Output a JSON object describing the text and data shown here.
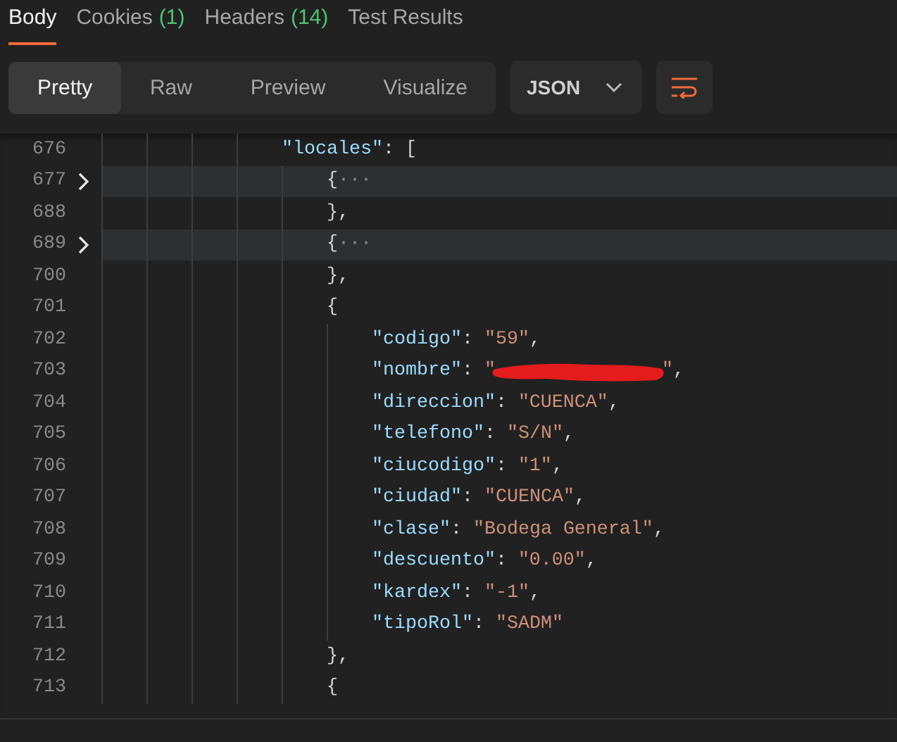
{
  "tabs": [
    {
      "label": "Body",
      "selected": true
    },
    {
      "label": "Cookies",
      "count": "(1)",
      "selected": false
    },
    {
      "label": "Headers",
      "count": "(14)",
      "selected": false
    },
    {
      "label": "Test Results",
      "selected": false
    }
  ],
  "view_modes": [
    {
      "label": "Pretty",
      "selected": true
    },
    {
      "label": "Raw",
      "selected": false
    },
    {
      "label": "Preview",
      "selected": false
    },
    {
      "label": "Visualize",
      "selected": false
    }
  ],
  "format_dropdown": {
    "value": "JSON"
  },
  "editor": {
    "lines": [
      {
        "number": "676",
        "folded": false,
        "tokens": [
          {
            "kind": "key",
            "text": "                \"locales\""
          },
          {
            "kind": "punct",
            "text": ": ["
          }
        ]
      },
      {
        "number": "677",
        "folded": true,
        "tokens": [
          {
            "kind": "punct",
            "text": "                    {"
          },
          {
            "kind": "fold",
            "text": "···"
          }
        ]
      },
      {
        "number": "688",
        "folded": false,
        "tokens": [
          {
            "kind": "punct",
            "text": "                    },"
          }
        ]
      },
      {
        "number": "689",
        "folded": true,
        "tokens": [
          {
            "kind": "punct",
            "text": "                    {"
          },
          {
            "kind": "fold",
            "text": "···"
          }
        ]
      },
      {
        "number": "700",
        "folded": false,
        "tokens": [
          {
            "kind": "punct",
            "text": "                    },"
          }
        ]
      },
      {
        "number": "701",
        "folded": false,
        "tokens": [
          {
            "kind": "punct",
            "text": "                    {"
          }
        ]
      },
      {
        "number": "702",
        "folded": false,
        "tokens": [
          {
            "kind": "key",
            "text": "                        \"codigo\""
          },
          {
            "kind": "punct",
            "text": ": "
          },
          {
            "kind": "string",
            "text": "\"59\""
          },
          {
            "kind": "punct",
            "text": ","
          }
        ]
      },
      {
        "number": "703",
        "folded": false,
        "tokens": [
          {
            "kind": "key",
            "text": "                        \"nombre\""
          },
          {
            "kind": "punct",
            "text": ": "
          },
          {
            "kind": "string",
            "text": "\""
          },
          {
            "kind": "redaction"
          },
          {
            "kind": "string",
            "text": "\""
          },
          {
            "kind": "punct",
            "text": ","
          }
        ]
      },
      {
        "number": "704",
        "folded": false,
        "tokens": [
          {
            "kind": "key",
            "text": "                        \"direccion\""
          },
          {
            "kind": "punct",
            "text": ": "
          },
          {
            "kind": "string",
            "text": "\"CUENCA\""
          },
          {
            "kind": "punct",
            "text": ","
          }
        ]
      },
      {
        "number": "705",
        "folded": false,
        "tokens": [
          {
            "kind": "key",
            "text": "                        \"telefono\""
          },
          {
            "kind": "punct",
            "text": ": "
          },
          {
            "kind": "string",
            "text": "\"S/N\""
          },
          {
            "kind": "punct",
            "text": ","
          }
        ]
      },
      {
        "number": "706",
        "folded": false,
        "tokens": [
          {
            "kind": "key",
            "text": "                        \"ciucodigo\""
          },
          {
            "kind": "punct",
            "text": ": "
          },
          {
            "kind": "string",
            "text": "\"1\""
          },
          {
            "kind": "punct",
            "text": ","
          }
        ]
      },
      {
        "number": "707",
        "folded": false,
        "tokens": [
          {
            "kind": "key",
            "text": "                        \"ciudad\""
          },
          {
            "kind": "punct",
            "text": ": "
          },
          {
            "kind": "string",
            "text": "\"CUENCA\""
          },
          {
            "kind": "punct",
            "text": ","
          }
        ]
      },
      {
        "number": "708",
        "folded": false,
        "tokens": [
          {
            "kind": "key",
            "text": "                        \"clase\""
          },
          {
            "kind": "punct",
            "text": ": "
          },
          {
            "kind": "string",
            "text": "\"Bodega General\""
          },
          {
            "kind": "punct",
            "text": ","
          }
        ]
      },
      {
        "number": "709",
        "folded": false,
        "tokens": [
          {
            "kind": "key",
            "text": "                        \"descuento\""
          },
          {
            "kind": "punct",
            "text": ": "
          },
          {
            "kind": "string",
            "text": "\"0.00\""
          },
          {
            "kind": "punct",
            "text": ","
          }
        ]
      },
      {
        "number": "710",
        "folded": false,
        "tokens": [
          {
            "kind": "key",
            "text": "                        \"kardex\""
          },
          {
            "kind": "punct",
            "text": ": "
          },
          {
            "kind": "string",
            "text": "\"-1\""
          },
          {
            "kind": "punct",
            "text": ","
          }
        ]
      },
      {
        "number": "711",
        "folded": false,
        "tokens": [
          {
            "kind": "key",
            "text": "                        \"tipoRol\""
          },
          {
            "kind": "punct",
            "text": ": "
          },
          {
            "kind": "string",
            "text": "\"SADM\""
          }
        ]
      },
      {
        "number": "712",
        "folded": false,
        "tokens": [
          {
            "kind": "punct",
            "text": "                    },"
          }
        ]
      },
      {
        "number": "713",
        "folded": false,
        "tokens": [
          {
            "kind": "punct",
            "text": "                    {"
          }
        ]
      }
    ]
  }
}
